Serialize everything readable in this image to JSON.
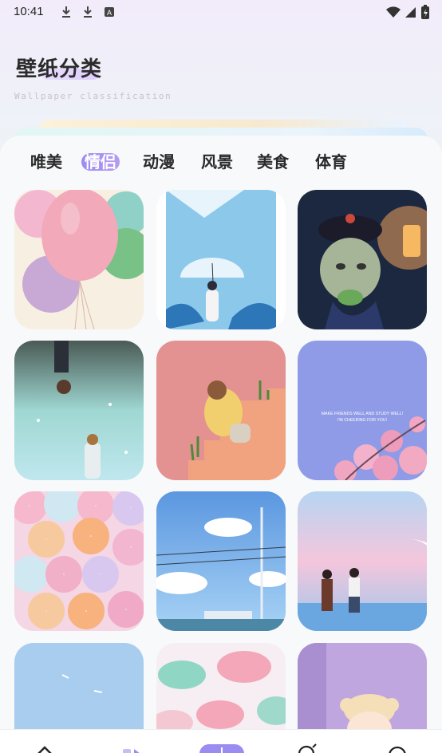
{
  "status_bar": {
    "time": "10:41",
    "icons": [
      "download-icon",
      "download-icon",
      "text-icon"
    ],
    "right_icons": [
      "wifi-icon",
      "signal-icon",
      "battery-icon"
    ]
  },
  "header": {
    "title": "壁纸分类",
    "subtitle": "Wallpaper classification"
  },
  "tabs": [
    {
      "label": "唯美",
      "active": false
    },
    {
      "label": "情侣",
      "active": true
    },
    {
      "label": "动漫",
      "active": false
    },
    {
      "label": "风景",
      "active": false
    },
    {
      "label": "美食",
      "active": false
    },
    {
      "label": "体育",
      "active": false
    }
  ],
  "wallpapers": [
    {
      "name": "balloons",
      "art_text": ""
    },
    {
      "name": "girl-umbrella-rain",
      "art_text": ""
    },
    {
      "name": "cartoon-figure-bowl",
      "art_text": ""
    },
    {
      "name": "sky-couple-dreamy",
      "art_text": ""
    },
    {
      "name": "girl-stairs-desert",
      "art_text": ""
    },
    {
      "name": "cherry-blossom-text",
      "art_text": "MAKE FRIENDS WELL AND STUDY WELL! I'M CHEERING FOR YOU!"
    },
    {
      "name": "donuts",
      "art_text": ""
    },
    {
      "name": "sky-power-lines",
      "art_text": ""
    },
    {
      "name": "couple-moon-sea",
      "art_text": ""
    },
    {
      "name": "blue-sky",
      "art_text": ""
    },
    {
      "name": "macarons",
      "art_text": ""
    },
    {
      "name": "anime-girl-purple",
      "art_text": ""
    }
  ],
  "bottom_nav": {
    "items": [
      "home-icon",
      "category-icon",
      "add-icon",
      "discover-icon",
      "profile-icon"
    ],
    "accent": "#9b8cf2"
  }
}
